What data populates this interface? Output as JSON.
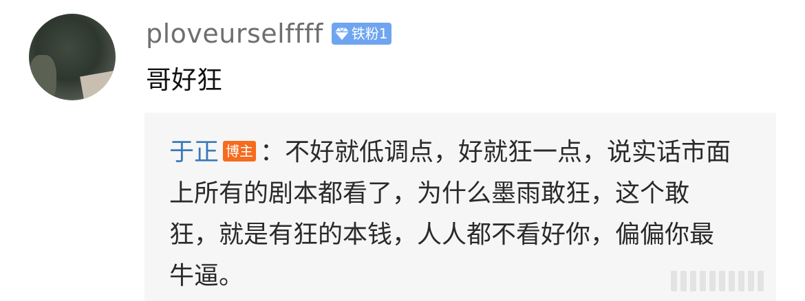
{
  "comment": {
    "username": "ploveurselffff",
    "fan_badge": {
      "icon": "diamond-icon",
      "label": "铁粉1",
      "color": "#6fa5f0"
    },
    "text": "哥好狂"
  },
  "reply": {
    "author": "于正",
    "author_badge": {
      "label": "博主",
      "color": "#f66b1e"
    },
    "separator": "：",
    "text": "不好就低调点，好就狂一点，说实话市面上所有的剧本都看了，为什么墨雨敢狂，这个敢狂，就是有狂的本钱，人人都不看好你，偏偏你最牛逼。"
  },
  "colors": {
    "reply_name": "#3b79b8",
    "reply_background": "#f6f6f6"
  }
}
